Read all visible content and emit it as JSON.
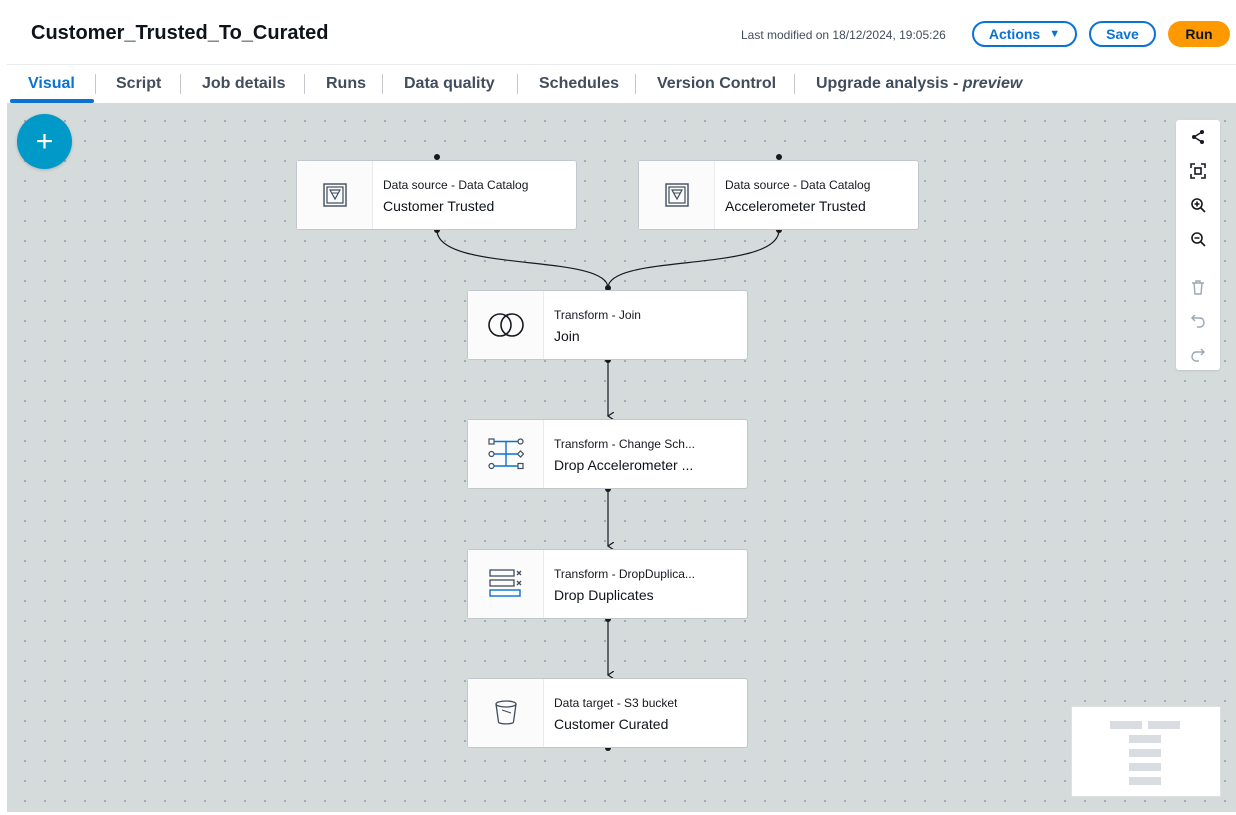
{
  "header": {
    "title": "Customer_Trusted_To_Curated",
    "last_modified": "Last modified on 18/12/2024, 19:05:26",
    "actions_label": "Actions",
    "save_label": "Save",
    "run_label": "Run"
  },
  "tabs": [
    {
      "label": "Visual",
      "active": true
    },
    {
      "label": "Script"
    },
    {
      "label": "Job details"
    },
    {
      "label": "Runs"
    },
    {
      "label": "Data quality"
    },
    {
      "label": "Schedules"
    },
    {
      "label": "Version Control"
    },
    {
      "label": "Upgrade analysis - ",
      "suffix": "preview"
    }
  ],
  "nodes": [
    {
      "kind": "Data source - Data Catalog",
      "name": "Customer Trusted",
      "icon": "data-catalog-icon"
    },
    {
      "kind": "Data source - Data Catalog",
      "name": "Accelerometer Trusted",
      "icon": "data-catalog-icon"
    },
    {
      "kind": "Transform - Join",
      "name": "Join",
      "icon": "join-icon"
    },
    {
      "kind": "Transform - Change Sch...",
      "name": "Drop Accelerometer ...",
      "icon": "change-schema-icon"
    },
    {
      "kind": "Transform - DropDuplica...",
      "name": "Drop Duplicates",
      "icon": "drop-duplicates-icon"
    },
    {
      "kind": "Data target - S3 bucket",
      "name": "Customer Curated",
      "icon": "s3-bucket-icon"
    }
  ],
  "toolbar": [
    "layout-icon",
    "fit-to-screen-icon",
    "zoom-in-icon",
    "zoom-out-icon",
    "delete-icon",
    "undo-icon",
    "redo-icon"
  ],
  "colors": {
    "accent": "#0972d3",
    "run": "#ff9900",
    "add": "#0099c8",
    "canvas": "#d5dbdb"
  }
}
